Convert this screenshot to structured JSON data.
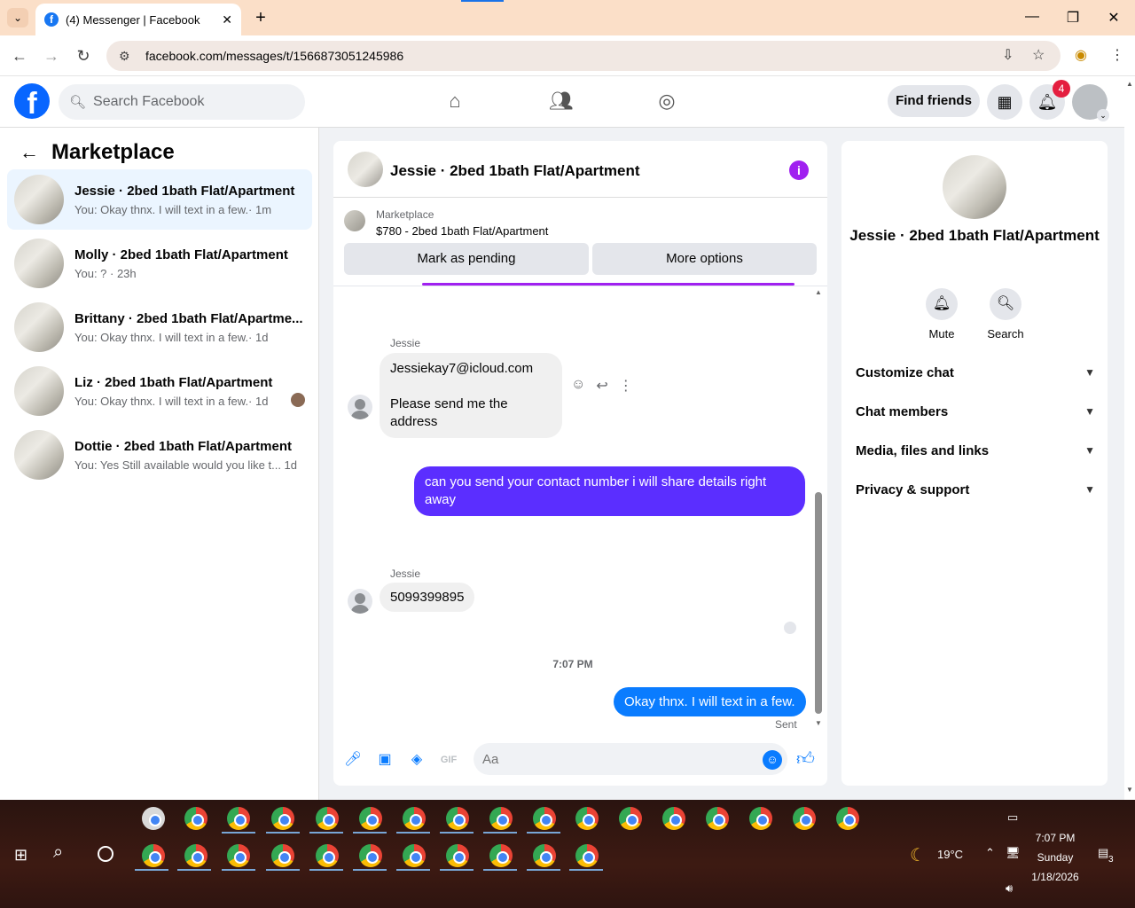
{
  "browser": {
    "tab_title": "(4) Messenger | Facebook",
    "url": "facebook.com/messages/t/1566873051245986"
  },
  "header": {
    "search_placeholder": "Search Facebook",
    "find_friends": "Find friends",
    "notification_count": "4"
  },
  "sidebar": {
    "title": "Marketplace",
    "conversations": [
      {
        "name": "Jessie · 2bed 1bath Flat/Apartment",
        "snippet": "You: Okay thnx. I will text in a few.· 1m",
        "active": true
      },
      {
        "name": "Molly · 2bed 1bath Flat/Apartment",
        "snippet": "You: ? · 23h"
      },
      {
        "name": "Brittany · 2bed 1bath Flat/Apartme...",
        "snippet": "You: Okay thnx. I will text in a few.· 1d"
      },
      {
        "name": "Liz · 2bed 1bath Flat/Apartment",
        "snippet": "You: Okay thnx. I will text in a few.· 1d"
      },
      {
        "name": "Dottie · 2bed 1bath Flat/Apartment",
        "snippet": "You: Yes Still available would you like t...  1d"
      }
    ]
  },
  "chat": {
    "title": "Jessie · 2bed 1bath Flat/Apartment",
    "marketplace_label": "Marketplace",
    "listing": "$780 - 2bed 1bath Flat/Apartment",
    "mark_pending": "Mark as pending",
    "more_options": "More options",
    "messages": {
      "sender1": "Jessie",
      "in1_line1": "Jessiekay7@icloud.com",
      "in1_line2": "Please send me the address",
      "out1": "can you send your contact number i will share details right away",
      "sender2": "Jessie",
      "in2": "5099399895",
      "timestamp": "7:07 PM",
      "out2": "Okay thnx. I will text in a few.",
      "status": "Sent"
    },
    "composer_placeholder": "Aa"
  },
  "right_panel": {
    "name": "Jessie · 2bed 1bath Flat/Apartment",
    "mute": "Mute",
    "search": "Search",
    "sections": [
      "Customize chat",
      "Chat members",
      "Media, files and links",
      "Privacy & support"
    ]
  },
  "taskbar": {
    "weather": "19°C",
    "time": "7:07 PM",
    "day": "Sunday",
    "date": "1/18/2026",
    "notif_count": "3"
  },
  "colors": {
    "fb_blue": "#0866ff",
    "out_bubble": "#5b2eff",
    "last_bubble": "#0a7cff"
  }
}
